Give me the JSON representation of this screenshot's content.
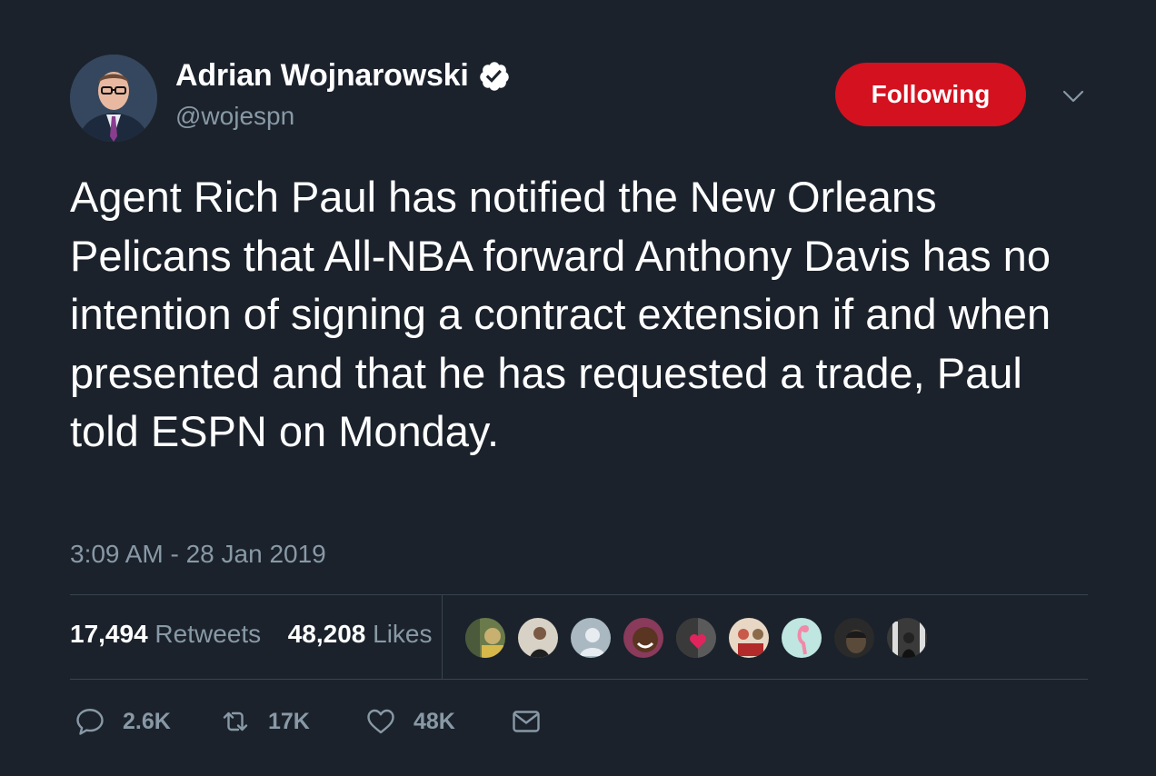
{
  "tweet": {
    "author": {
      "name": "Adrian Wojnarowski",
      "handle": "@wojespn",
      "verified": true,
      "avatar_icon": "profile-photo"
    },
    "follow_button_label": "Following",
    "text": "Agent Rich Paul has notified the New Orleans Pelicans that All-NBA forward Anthony Davis has no intention of signing a contract extension if and when presented and that he has requested a trade, Paul told ESPN on Monday.",
    "timestamp": "3:09 AM - 28 Jan 2019",
    "stats": {
      "retweets_count": "17,494",
      "retweets_label": "Retweets",
      "likes_count": "48,208",
      "likes_label": "Likes"
    },
    "likers": [
      {
        "icon": "liker-avatar-1",
        "color": "#6b7a4a"
      },
      {
        "icon": "liker-avatar-2",
        "color": "#d8d2c6"
      },
      {
        "icon": "liker-avatar-default",
        "color": "#aab8c2"
      },
      {
        "icon": "liker-avatar-4",
        "color": "#8a3a5a"
      },
      {
        "icon": "liker-avatar-5",
        "color": "#5a5a5a"
      },
      {
        "icon": "liker-avatar-6",
        "color": "#e9d7c5"
      },
      {
        "icon": "liker-avatar-7",
        "color": "#bfe6e0"
      },
      {
        "icon": "liker-avatar-8",
        "color": "#2a2a2a"
      },
      {
        "icon": "liker-avatar-9",
        "color": "#3a3a3a"
      }
    ],
    "actions": {
      "reply_count": "2.6K",
      "retweet_count": "17K",
      "like_count": "48K",
      "dm_icon": "envelope-icon"
    }
  },
  "colors": {
    "background": "#1b222c",
    "text": "#ffffff",
    "muted": "#8899a6",
    "divider": "#38444d",
    "follow_button": "#d4111f"
  }
}
